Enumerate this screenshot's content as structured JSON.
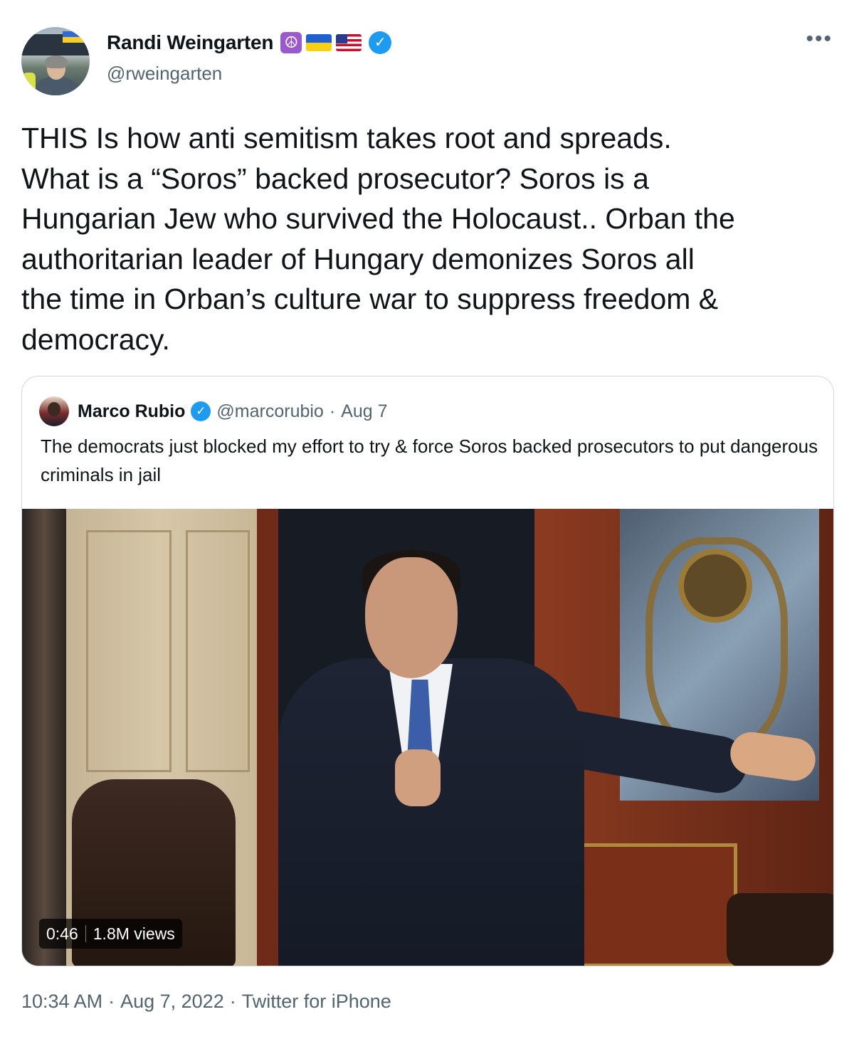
{
  "author": {
    "name": "Randi Weingarten",
    "handle": "@rweingarten",
    "emoji_badges": [
      "peace-symbol",
      "ukraine-flag",
      "us-flag"
    ],
    "peace_glyph": "☮",
    "verified_glyph": "✓",
    "avatar_icon": "author-avatar"
  },
  "menu": {
    "more_glyph": "•••"
  },
  "tweet": {
    "text": "THIS Is how anti semitism takes root and spreads.\nWhat is a “Soros” backed prosecutor? Soros is a\nHungarian Jew who survived the Holocaust.. Orban the\nauthoritarian leader of Hungary demonizes Soros all\nthe time in Orban’s culture war to suppress freedom &\ndemocracy."
  },
  "quoted_tweet": {
    "name": "Marco Rubio",
    "verified_glyph": "✓",
    "handle": "@marcorubio",
    "separator": "·",
    "date": "Aug 7",
    "text": "The democrats just blocked my effort to try & force Soros backed prosecutors to put dangerous criminals in jail",
    "media": {
      "type": "video",
      "duration": "0:46",
      "views": "1.8M views"
    }
  },
  "footer": {
    "time": "10:34 AM",
    "sep1": "·",
    "date": "Aug 7, 2022",
    "sep2": "·",
    "source": "Twitter for iPhone"
  },
  "colors": {
    "text_primary": "#0f1419",
    "text_secondary": "#536471",
    "verified_blue": "#1d9bf0",
    "border": "#cfd9de"
  }
}
